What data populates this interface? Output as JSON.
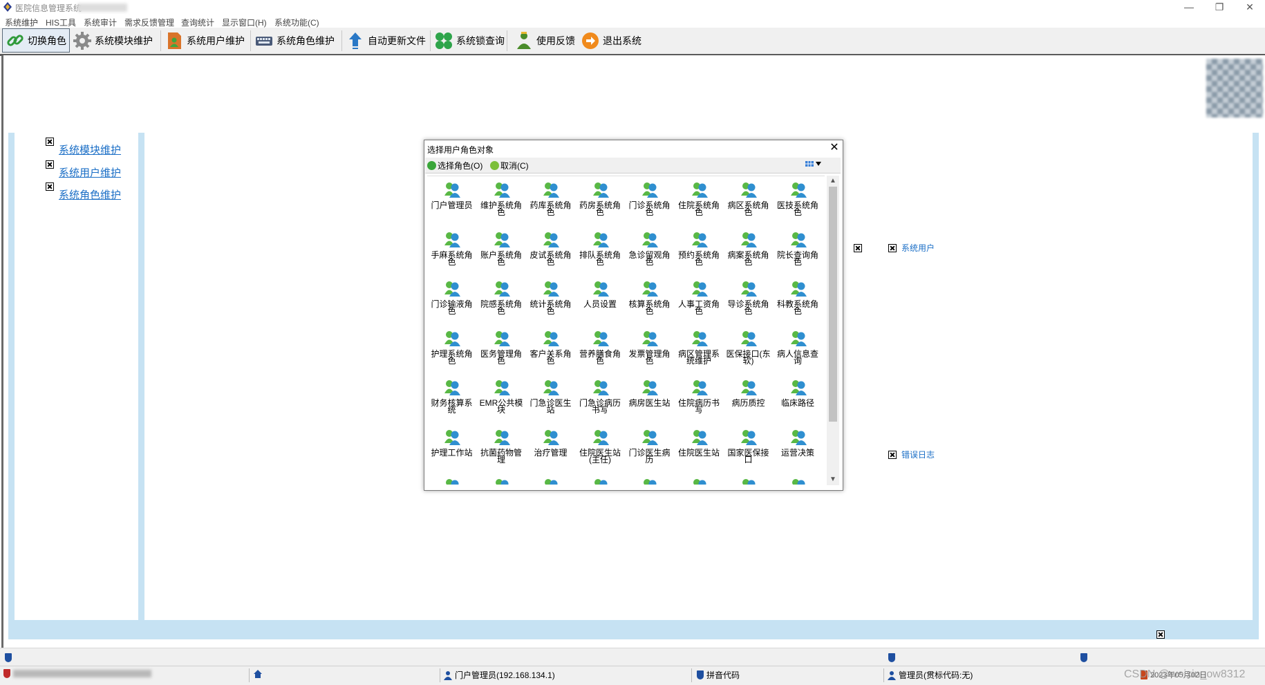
{
  "window": {
    "title": "医院信息管理系统",
    "controls": {
      "minimize": "—",
      "restore": "❐",
      "close": "✕"
    }
  },
  "menu": [
    "系统维护",
    "HIS工具",
    "系统审计",
    "需求反馈管理",
    "查询统计",
    "显示窗口(H)",
    "系统功能(C)"
  ],
  "toolbar": {
    "switch_role": "切换角色",
    "module_maint": "系统模块维护",
    "user_maint": "系统用户维护",
    "role_maint": "系统角色维护",
    "auto_update": "自动更新文件",
    "lock_query": "系统锁查询",
    "feedback": "使用反馈",
    "exit": "退出系统"
  },
  "left_links": [
    "系统模块维护",
    "系统用户维护",
    "系统角色维护"
  ],
  "right_links": {
    "system_user": "系统用户",
    "error_log": "错误日志"
  },
  "dialog": {
    "title": "选择用户角色对象",
    "select_btn": "选择角色(O)",
    "cancel_btn": "取消(C)",
    "items": [
      "门户管理员",
      "维护系统角色",
      "药库系统角色",
      "药房系统角色",
      "门诊系统角色",
      "住院系统角色",
      "病区系统角色",
      "医技系统角色",
      "手麻系统角色",
      "账户系统角色",
      "皮试系统角色",
      "排队系统角色",
      "急诊留观角色",
      "预约系统角色",
      "病案系统角色",
      "院长查询角色",
      "门诊输液角色",
      "院感系统角色",
      "统计系统角色",
      "人员设置",
      "核算系统角色",
      "人事工资角色",
      "导诊系统角色",
      "科教系统角色",
      "护理系统角色",
      "医务管理角色",
      "客户关系角色",
      "营养膳食角色",
      "发票管理角色",
      "病区管理系统维护",
      "医保接口(东软)",
      "病人信息查询",
      "财务核算系统",
      "EMR公共模块",
      "门急诊医生站",
      "门急诊病历书写",
      "病房医生站",
      "住院病历书写",
      "病历质控",
      "临床路径",
      "护理工作站",
      "抗菌药物管理",
      "治疗管理",
      "住院医生站(主任)",
      "门诊医生病历",
      "住院医生站",
      "国家医保接口",
      "运营决策"
    ]
  },
  "status": {
    "portal_user": "门户管理员(192.168.134.1)",
    "input_method": "拼音代码",
    "admin": "管理员(贯标代码:无)",
    "date_partial": "2023年05月02日",
    "watermark": "CSDN @weixin_ow8312"
  },
  "colors": {
    "link": "#1a6ec6",
    "band": "#c6e2f3",
    "role_icon": "#2f8fd0",
    "role_icon_alt": "#59b845"
  }
}
